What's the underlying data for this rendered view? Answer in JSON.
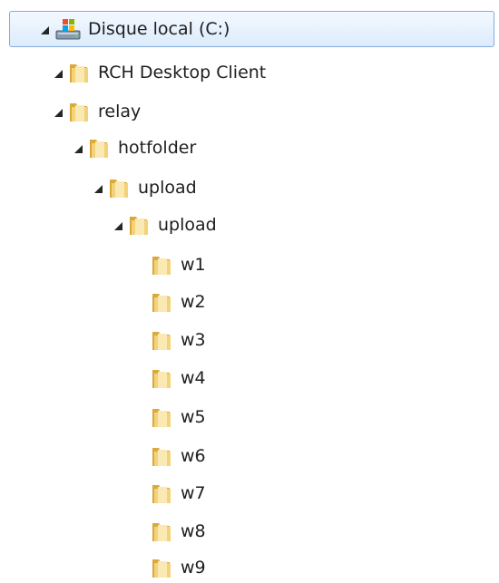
{
  "tree": {
    "items": [
      {
        "label": "Disque local (C:)",
        "icon": "drive-icon",
        "expanded": true,
        "selected": true
      },
      {
        "label": "RCH Desktop Client",
        "icon": "folder-icon",
        "expanded": true
      },
      {
        "label": "relay",
        "icon": "folder-icon",
        "expanded": true
      },
      {
        "label": "hotfolder",
        "icon": "folder-icon",
        "expanded": true
      },
      {
        "label": "upload",
        "icon": "folder-icon",
        "expanded": true
      },
      {
        "label": "upload",
        "icon": "folder-icon",
        "expanded": true
      },
      {
        "label": "w1",
        "icon": "folder-icon",
        "expanded": false
      },
      {
        "label": "w2",
        "icon": "folder-icon",
        "expanded": false
      },
      {
        "label": "w3",
        "icon": "folder-icon",
        "expanded": false
      },
      {
        "label": "w4",
        "icon": "folder-icon",
        "expanded": false
      },
      {
        "label": "w5",
        "icon": "folder-icon",
        "expanded": false
      },
      {
        "label": "w6",
        "icon": "folder-icon",
        "expanded": false
      },
      {
        "label": "w7",
        "icon": "folder-icon",
        "expanded": false
      },
      {
        "label": "w8",
        "icon": "folder-icon",
        "expanded": false
      },
      {
        "label": "w9",
        "icon": "folder-icon",
        "expanded": false
      }
    ],
    "colors": {
      "selection_border": "#84acdd",
      "selection_fill": "#dcebfc",
      "folder": "#e8c25a"
    }
  }
}
